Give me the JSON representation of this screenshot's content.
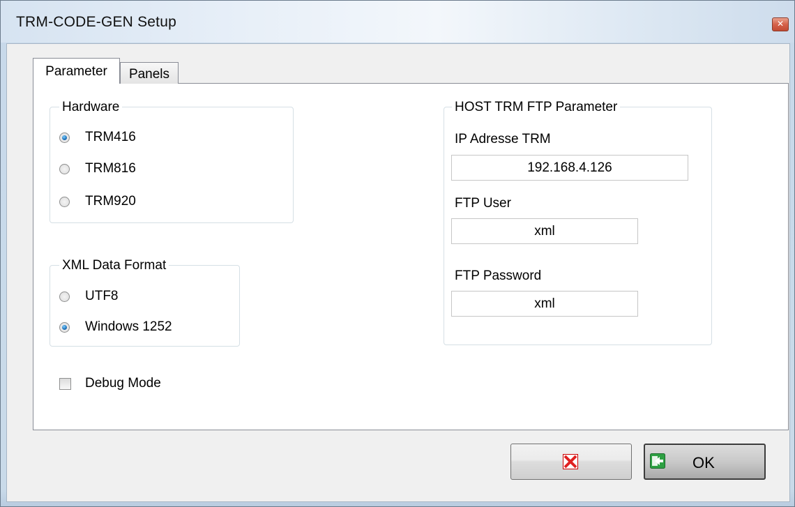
{
  "window": {
    "title": "TRM-CODE-GEN Setup",
    "close_glyph": "✕"
  },
  "tabs": [
    {
      "label": "Parameter",
      "active": true
    },
    {
      "label": "Panels",
      "active": false
    }
  ],
  "hardware": {
    "legend": "Hardware",
    "options": [
      {
        "label": "TRM416",
        "selected": true
      },
      {
        "label": "TRM816",
        "selected": false
      },
      {
        "label": "TRM920",
        "selected": false
      }
    ]
  },
  "xml_format": {
    "legend": "XML Data Format",
    "options": [
      {
        "label": "UTF8",
        "selected": false
      },
      {
        "label": "Windows 1252",
        "selected": true
      }
    ]
  },
  "debug": {
    "label": "Debug Mode",
    "checked": false
  },
  "ftp": {
    "legend": "HOST TRM FTP Parameter",
    "ip_label": "IP Adresse TRM",
    "ip_value": "192.168.4.126",
    "user_label": "FTP User",
    "user_value": "xml",
    "password_label": "FTP Password",
    "password_value": "xml"
  },
  "buttons": {
    "cancel_icon": "red-x-icon",
    "ok_icon": "green-arrow-icon",
    "ok_label": "OK"
  },
  "colors": {
    "cancel_red": "#e02020",
    "ok_green": "#2ea043"
  }
}
